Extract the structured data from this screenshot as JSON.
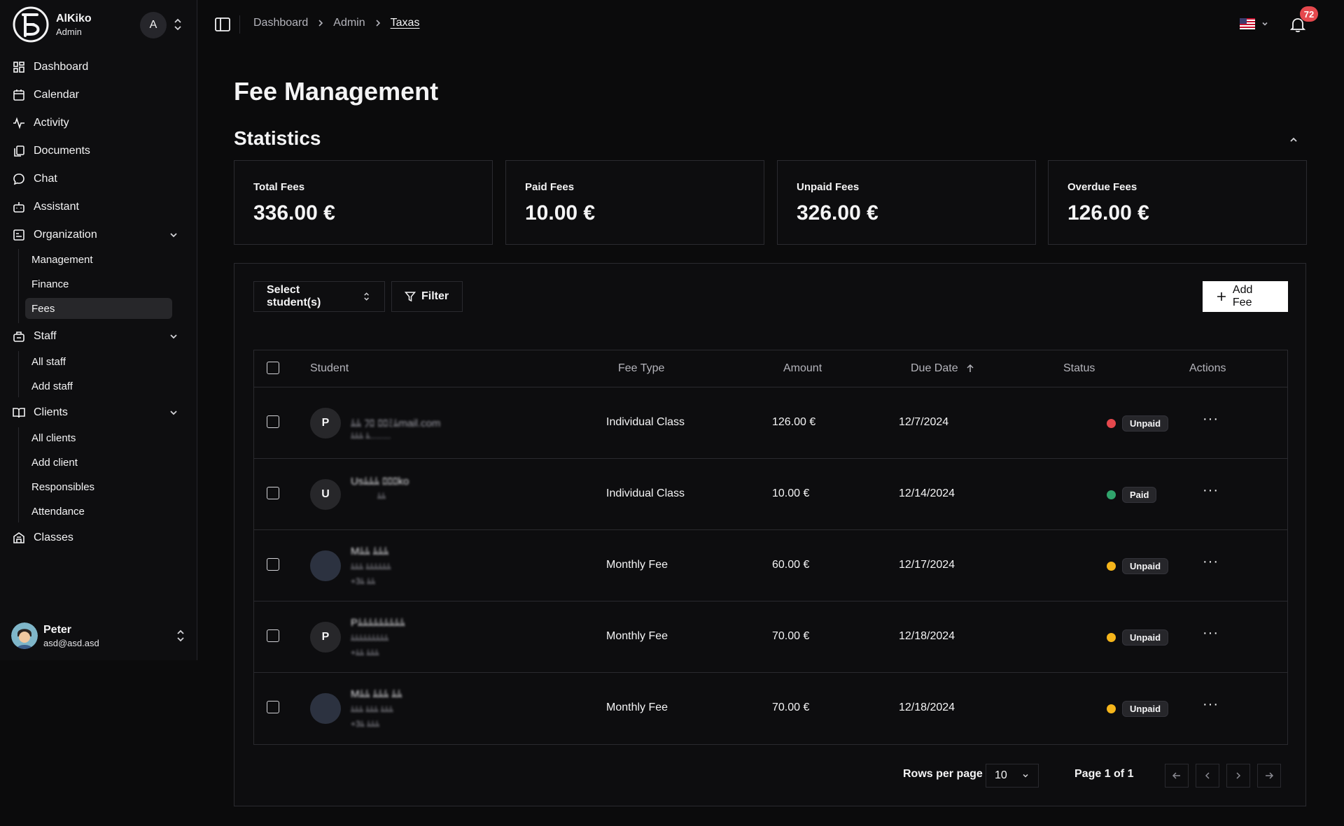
{
  "app": {
    "name": "AlKiko",
    "role": "Admin",
    "account_initial": "A"
  },
  "sidebar": {
    "items": [
      {
        "label": "Dashboard",
        "icon": "dashboard-icon"
      },
      {
        "label": "Calendar",
        "icon": "calendar-icon"
      },
      {
        "label": "Activity",
        "icon": "activity-icon"
      },
      {
        "label": "Documents",
        "icon": "documents-icon"
      },
      {
        "label": "Chat",
        "icon": "chat-icon"
      },
      {
        "label": "Assistant",
        "icon": "bot-icon"
      },
      {
        "label": "Organization",
        "icon": "organization-icon"
      },
      {
        "label": "Staff",
        "icon": "staff-icon"
      },
      {
        "label": "Clients",
        "icon": "book-icon"
      },
      {
        "label": "Classes",
        "icon": "building-icon"
      }
    ],
    "organization_sub": [
      "Management",
      "Finance",
      "Fees"
    ],
    "staff_sub": [
      "All staff",
      "Add staff"
    ],
    "clients_sub": [
      "All clients",
      "Add client",
      "Responsibles",
      "Attendance"
    ],
    "active": "Fees"
  },
  "user": {
    "name": "Peter",
    "email": "asd@asd.asd"
  },
  "header": {
    "breadcrumb": [
      "Dashboard",
      "Admin",
      "Taxas"
    ],
    "language": "en-US",
    "notifications": "72"
  },
  "page": {
    "title": "Fee Management",
    "section": "Statistics"
  },
  "stats": [
    {
      "label": "Total Fees",
      "value": "336.00 €"
    },
    {
      "label": "Paid Fees",
      "value": "10.00 €"
    },
    {
      "label": "Unpaid Fees",
      "value": "326.00 €"
    },
    {
      "label": "Overdue Fees",
      "value": "126.00 €"
    }
  ],
  "toolbar": {
    "select_students": "Select student(s)",
    "filter": "Filter",
    "add_fee": "Add Fee"
  },
  "table": {
    "headers": [
      "Student",
      "Fee Type",
      "Amount",
      "Due Date",
      "Status",
      "Actions"
    ],
    "rows": [
      {
        "initial": "P",
        "line1": "ﾑﾑ ﾌﾛ ﾛﾛﾐﾑmail.com",
        "line2": "ﾑﾑﾑ ﾑ.........",
        "fee_type": "Individual Class",
        "amount": "126.00 €",
        "due": "12/7/2024",
        "status": "Unpaid",
        "status_color": "#e5484d"
      },
      {
        "initial": "U",
        "line1": "Usﾑﾑﾑ ﾛﾛﾛko",
        "line2": "ﾑﾑ",
        "fee_type": "Individual Class",
        "amount": "10.00 €",
        "due": "12/14/2024",
        "status": "Paid",
        "status_color": "#30a46c"
      },
      {
        "initial": "",
        "line1": "Mﾑﾑ ﾑﾑﾑ",
        "line2": "ﾑﾑﾑ ﾑﾑﾑﾑﾑﾑ",
        "line3": "+3ﾑ ﾑﾑ",
        "fee_type": "Monthly Fee",
        "amount": "60.00 €",
        "due": "12/17/2024",
        "status": "Unpaid",
        "status_color": "#f5b51b"
      },
      {
        "initial": "P",
        "line1": "Pﾑﾑﾑﾑﾑﾑﾑﾑﾑ",
        "line2": "ﾑﾑﾑﾑﾑﾑﾑﾑﾑ",
        "line3": "+ﾑﾑ ﾑﾑﾑ",
        "fee_type": "Monthly Fee",
        "amount": "70.00 €",
        "due": "12/18/2024",
        "status": "Unpaid",
        "status_color": "#f5b51b"
      },
      {
        "initial": "",
        "line1": "Mﾑﾑ ﾑﾑﾑ ﾑﾑ",
        "line2": "ﾑﾑﾑ ﾑﾑﾑ ﾑﾑﾑ",
        "line3": "+3ﾑ ﾑﾑﾑ",
        "fee_type": "Monthly Fee",
        "amount": "70.00 €",
        "due": "12/18/2024",
        "status": "Unpaid",
        "status_color": "#f5b51b"
      }
    ]
  },
  "pagination": {
    "rows_label": "Rows per page",
    "rows_value": "10",
    "page_label": "Page 1 of 1"
  }
}
